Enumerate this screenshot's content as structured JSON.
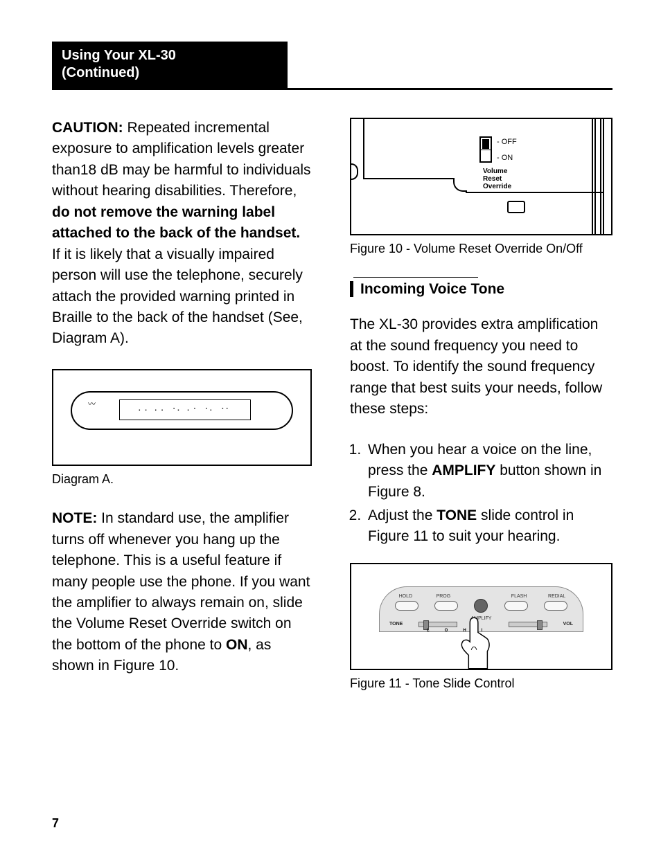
{
  "header": {
    "title_line1": "Using Your XL-30",
    "title_line2": "(Continued)"
  },
  "left": {
    "caution_label": "CAUTION:",
    "caution_text_1": " Repeated incremental exposure to amplification levels greater than18 dB may be harmful to individuals without hearing disabilities. Therefore, ",
    "caution_bold": "do not remove the warning label attached to the back of the handset.",
    "caution_text_2": " If it is likely that a visually impaired person will use the telephone, securely attach the provided warning printed in Braille to the back of the handset (See, Diagram A).",
    "diagram_a_caption": "Diagram A.",
    "braille_dots": "⠄⠄ ⠄⠄ ⠐⠄ ⠄⠂ ⠐⠄ ⠐⠂",
    "note_label": "NOTE:",
    "note_text_1": " In standard use, the amplifier turns off whenever you hang up the telephone. This is a useful feature if many people use the phone. If you want the amplifier to always remain on, slide the Volume Reset Override switch on the bottom of the phone to ",
    "note_on": "ON",
    "note_text_2": ", as shown in Figure 10."
  },
  "right": {
    "fig10": {
      "off": "- OFF",
      "on": "- ON",
      "vro_l1": "Volume",
      "vro_l2": "Reset",
      "vro_l3": "Override",
      "caption": "Figure 10 - Volume Reset Override On/Off"
    },
    "section_title": "Incoming Voice Tone",
    "intro": "The XL-30 provides extra amplification at the sound frequency you need to boost. To identify the sound frequency range that best suits your needs, follow these steps:",
    "step1_a": "When you hear a voice on the line, press the ",
    "step1_b": "AMPLIFY",
    "step1_c": " button shown in Figure 8.",
    "step2_a": "Adjust the ",
    "step2_b": "TONE",
    "step2_c": " slide control in Figure 11 to suit your hearing.",
    "fig11": {
      "hold": "HOLD",
      "prog": "PROG",
      "flash": "FLASH",
      "redial": "REDIAL",
      "amplify": "AMPLIFY",
      "tone": "TONE",
      "lo": "LO",
      "hi": "HI",
      "vol": "VOL",
      "caption": "Figure 11 - Tone Slide Control"
    }
  },
  "page_number": "7"
}
